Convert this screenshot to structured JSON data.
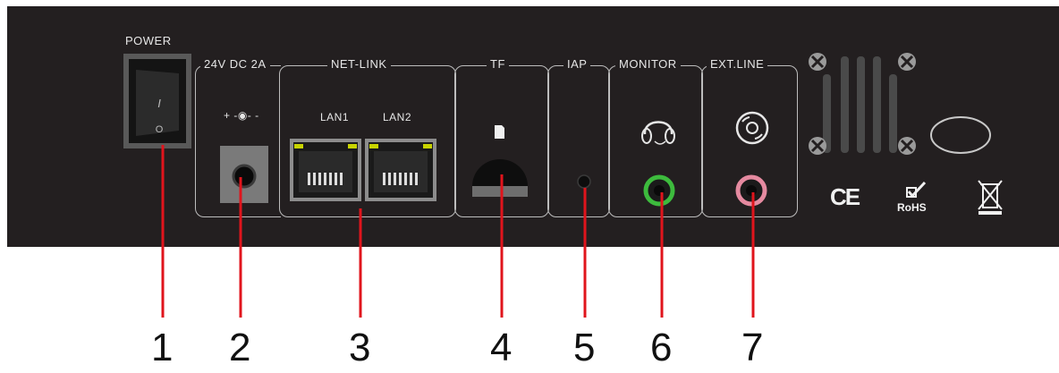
{
  "panel": {
    "power_label": "POWER",
    "power_switch_mark_on": "I",
    "power_switch_mark_off": "O",
    "dc_label": "24V DC 2A",
    "dc_polarity": "+ -◉- -",
    "netlink_label": "NET-LINK",
    "lan1_label": "LAN1",
    "lan2_label": "LAN2",
    "tf_label": "TF",
    "iap_label": "IAP",
    "monitor_label": "MONITOR",
    "extline_label": "EXT.LINE",
    "ce_mark": "CE",
    "rohs_mark": "RoHS",
    "colors": {
      "panel": "#231f20",
      "monitor_jack": "#3dbb3d",
      "extline_jack": "#e58aa0",
      "callout_line": "#e0141c",
      "lan_led": "#c8d400"
    }
  },
  "callouts": [
    "1",
    "2",
    "3",
    "4",
    "5",
    "6",
    "7"
  ]
}
